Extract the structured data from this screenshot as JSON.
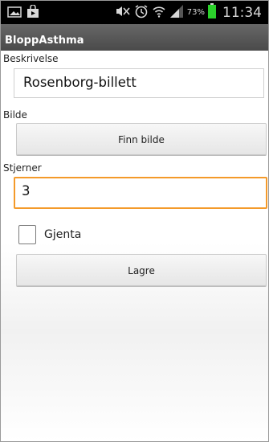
{
  "status_bar": {
    "time": "11:34",
    "battery_percent": "73%",
    "icons": [
      "image-icon",
      "shopping-bag-icon",
      "mute-icon",
      "alarm-icon",
      "wifi-icon",
      "signal-icon",
      "battery-icon"
    ]
  },
  "app": {
    "title": "BloppAsthma"
  },
  "form": {
    "description_label": "Beskrivelse",
    "description_value": "Rosenborg-billett",
    "image_label": "Bilde",
    "find_image_button": "Finn bilde",
    "stars_label": "Stjerner",
    "stars_value": "3",
    "repeat_label": "Gjenta",
    "repeat_checked": false,
    "save_button": "Lagre"
  },
  "colors": {
    "focus_border": "#f49a2a",
    "status_bar_bg": "#000000",
    "title_bar_bg": "#5a5a5a",
    "battery_green": "#2bd12b"
  }
}
